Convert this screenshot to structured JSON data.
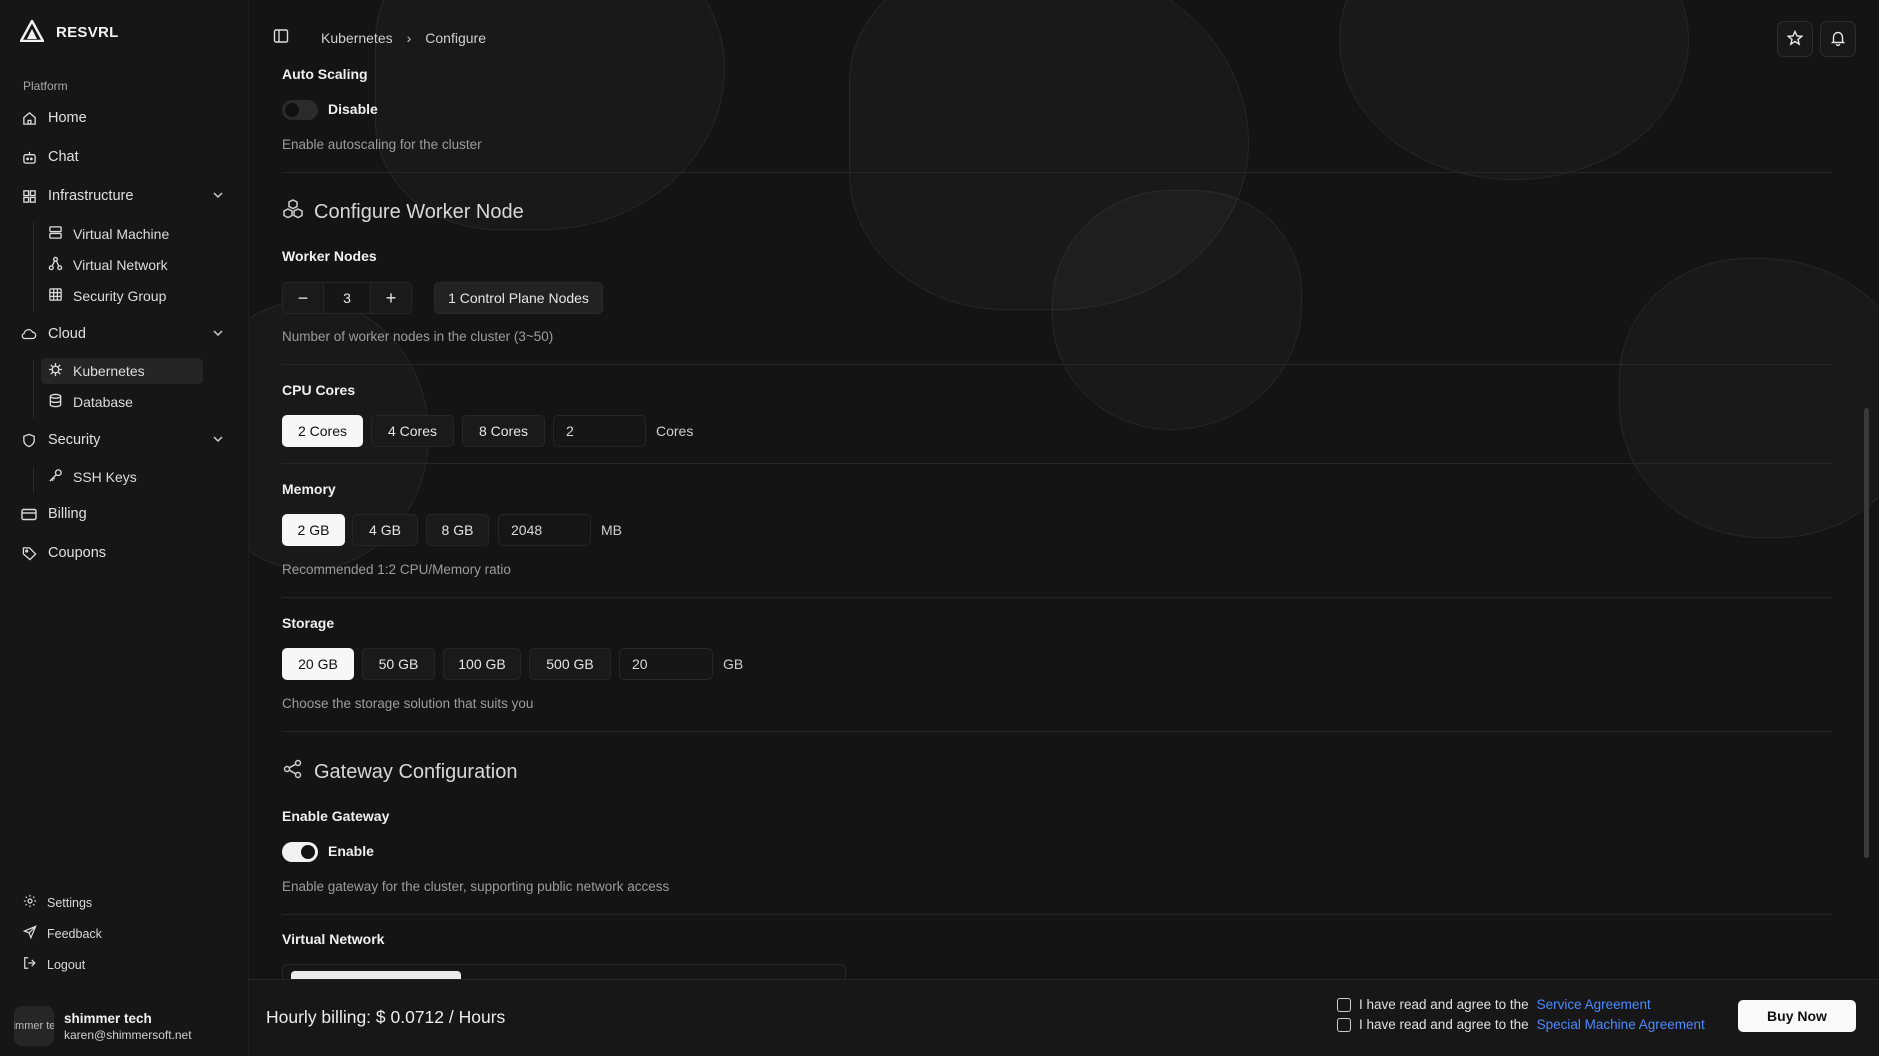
{
  "brand": {
    "name": "RESVRL"
  },
  "sidebar": {
    "section_label": "Platform",
    "items": {
      "home": "Home",
      "chat": "Chat",
      "infrastructure": "Infrastructure",
      "virtual_machine": "Virtual Machine",
      "virtual_network": "Virtual Network",
      "security_group": "Security Group",
      "cloud": "Cloud",
      "kubernetes": "Kubernetes",
      "database": "Database",
      "security": "Security",
      "ssh_keys": "SSH Keys",
      "billing": "Billing",
      "coupons": "Coupons"
    },
    "bottom": {
      "settings": "Settings",
      "feedback": "Feedback",
      "logout": "Logout"
    },
    "user": {
      "avatar_text": "shimmer tech",
      "name": "shimmer tech",
      "email": "karen@shimmersoft.net"
    }
  },
  "breadcrumb": {
    "parent": "Kubernetes",
    "separator": "›",
    "current": "Configure"
  },
  "auto_scaling": {
    "label": "Auto Scaling",
    "toggle_text": "Disable",
    "help": "Enable autoscaling for the cluster"
  },
  "worker": {
    "section_title": "Configure Worker Node",
    "nodes_label": "Worker Nodes",
    "minus": "−",
    "value": "3",
    "plus": "+",
    "control_plane": "1 Control Plane Nodes",
    "help": "Number of worker nodes in the cluster (3~50)"
  },
  "cpu": {
    "label": "CPU Cores",
    "options": [
      "2 Cores",
      "4 Cores",
      "8 Cores"
    ],
    "selected_index": 0,
    "custom_value": "2",
    "unit": "Cores"
  },
  "memory": {
    "label": "Memory",
    "options": [
      "2 GB",
      "4 GB",
      "8 GB"
    ],
    "selected_index": 0,
    "custom_value": "2048",
    "unit": "MB",
    "help": "Recommended 1:2 CPU/Memory ratio"
  },
  "storage": {
    "label": "Storage",
    "options": [
      "20 GB",
      "50 GB",
      "100 GB",
      "500 GB"
    ],
    "selected_index": 0,
    "custom_value": "20",
    "unit": "GB",
    "help": "Choose the storage solution that suits you"
  },
  "gateway": {
    "section_title": "Gateway Configuration",
    "label": "Enable Gateway",
    "toggle_text": "Enable",
    "help": "Enable gateway for the cluster, supporting public network access"
  },
  "virtual_network": {
    "label": "Virtual Network"
  },
  "footer": {
    "billing": "Hourly billing: $ 0.0712 / Hours",
    "agree_prefix": "I have read and agree to the",
    "service_agreement": "Service Agreement",
    "special_agreement": "Special Machine Agreement",
    "buy_label": "Buy Now"
  },
  "colors": {
    "link": "#4d8bff",
    "background": "#141414",
    "selected_chip": "#f7f7f7"
  }
}
